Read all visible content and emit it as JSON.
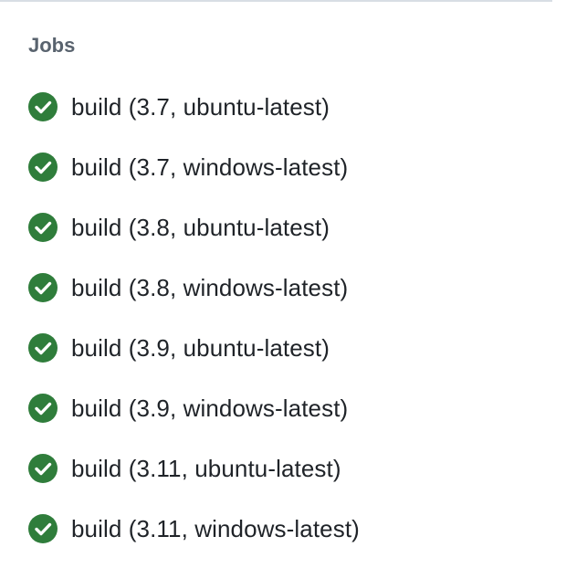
{
  "jobs_panel": {
    "title": "Jobs",
    "success_color": "#2f7d3b",
    "items": [
      {
        "label": "build (3.7, ubuntu-latest)",
        "status": "success",
        "icon": "check-circle-icon"
      },
      {
        "label": "build (3.7, windows-latest)",
        "status": "success",
        "icon": "check-circle-icon"
      },
      {
        "label": "build (3.8, ubuntu-latest)",
        "status": "success",
        "icon": "check-circle-icon"
      },
      {
        "label": "build (3.8, windows-latest)",
        "status": "success",
        "icon": "check-circle-icon"
      },
      {
        "label": "build (3.9, ubuntu-latest)",
        "status": "success",
        "icon": "check-circle-icon"
      },
      {
        "label": "build (3.9, windows-latest)",
        "status": "success",
        "icon": "check-circle-icon"
      },
      {
        "label": "build (3.11, ubuntu-latest)",
        "status": "success",
        "icon": "check-circle-icon"
      },
      {
        "label": "build (3.11, windows-latest)",
        "status": "success",
        "icon": "check-circle-icon"
      }
    ]
  }
}
